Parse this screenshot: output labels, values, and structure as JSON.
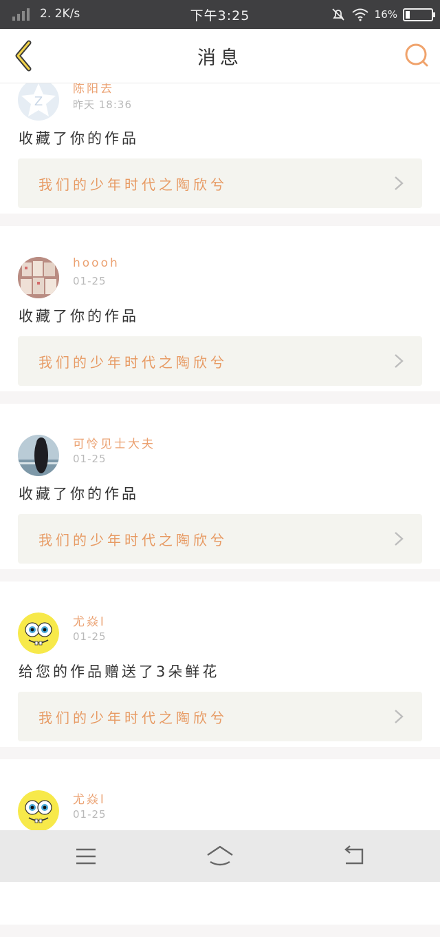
{
  "status_bar": {
    "network_speed": "2. 2K/s",
    "time": "下午3:25",
    "battery_percent": "16%",
    "battery_level": 0.16
  },
  "header": {
    "title": "消息"
  },
  "messages": [
    {
      "user": "陈阳去",
      "time": "昨天 18:36",
      "action": "收藏了你的作品",
      "work_title": "我们的少年时代之陶欣兮",
      "avatar": "qq-default-avatar"
    },
    {
      "user": "hoooh",
      "time": "01-25",
      "action": "收藏了你的作品",
      "work_title": "我们的少年时代之陶欣兮",
      "avatar": "photo-avatar"
    },
    {
      "user": "可怜见士大夫",
      "time": "01-25",
      "action": "收藏了你的作品",
      "work_title": "我们的少年时代之陶欣兮",
      "avatar": "girl-seaside-avatar"
    },
    {
      "user": "尤焱l",
      "time": "01-25",
      "action": "给您的作品赠送了3朵鲜花",
      "work_title": "我们的少年时代之陶欣兮",
      "avatar": "spongebob-avatar"
    },
    {
      "user": "尤焱l",
      "time": "01-25",
      "action": "",
      "work_title": "",
      "avatar": "spongebob-avatar"
    }
  ],
  "colors": {
    "accent": "#eba171",
    "work_bg": "#f4f4ef",
    "status_bar": "#3f3f41"
  },
  "nav": {
    "menu_icon": "menu-icon",
    "home_icon": "home-icon",
    "back_icon": "return-icon"
  }
}
